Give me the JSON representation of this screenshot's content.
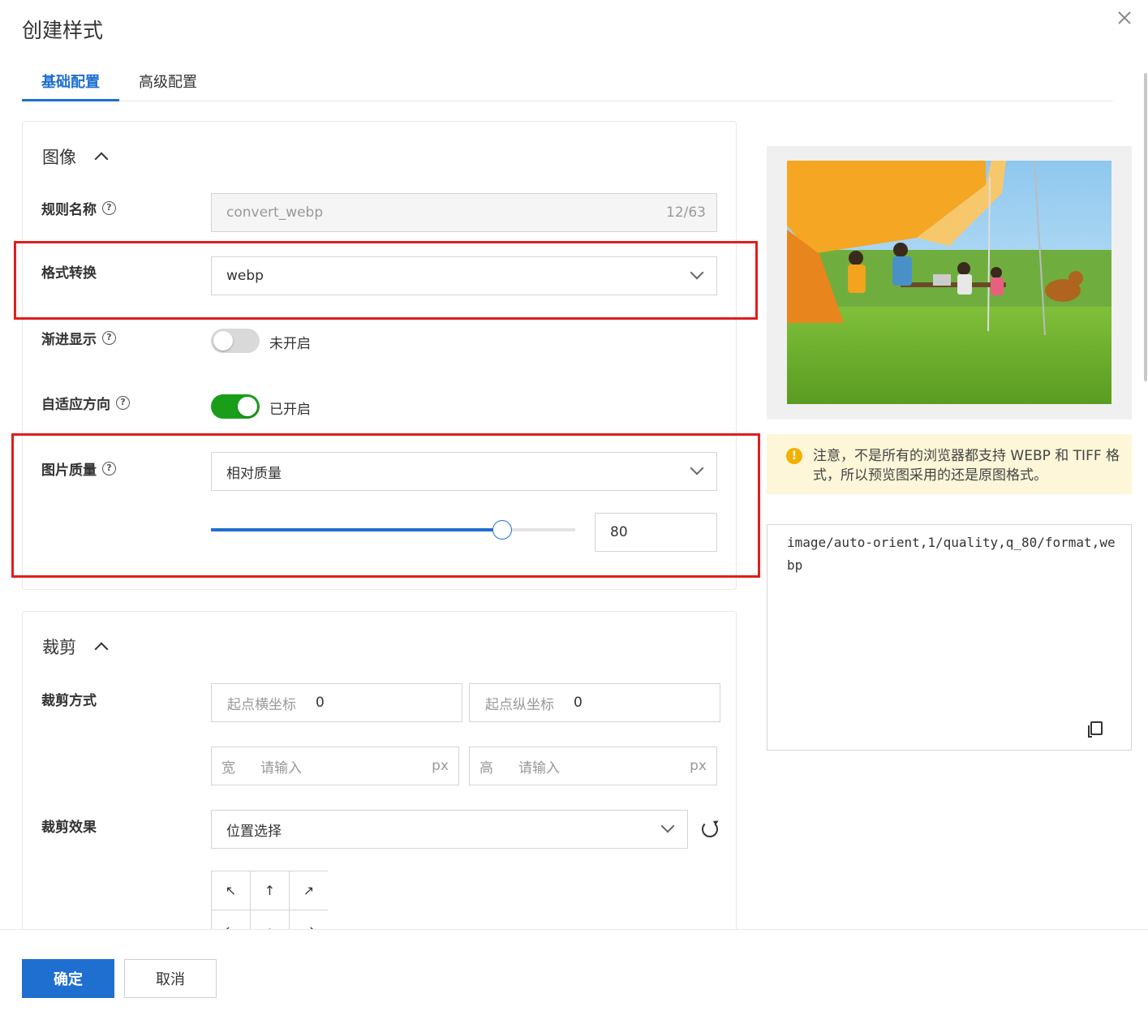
{
  "dialog": {
    "title": "创建样式"
  },
  "tabs": [
    {
      "label": "基础配置",
      "active": true
    },
    {
      "label": "高级配置",
      "active": false
    }
  ],
  "image_section": {
    "heading": "图像",
    "rule_name": {
      "label": "规则名称",
      "value": "convert_webp",
      "counter": "12/63"
    },
    "format": {
      "label": "格式转换",
      "value": "webp"
    },
    "progressive": {
      "label": "渐进显示",
      "enabled": false,
      "status": "未开启"
    },
    "auto_orient": {
      "label": "自适应方向",
      "enabled": true,
      "status": "已开启"
    },
    "quality": {
      "label": "图片质量",
      "mode": "相对质量",
      "value": "80",
      "slider_percent": 80
    }
  },
  "crop_section": {
    "heading": "裁剪",
    "method_label": "裁剪方式",
    "start_x": {
      "label": "起点横坐标",
      "value": "0"
    },
    "start_y": {
      "label": "起点纵坐标",
      "value": "0"
    },
    "width": {
      "label": "宽",
      "placeholder": "请输入",
      "unit": "px"
    },
    "height": {
      "label": "高",
      "placeholder": "请输入",
      "unit": "px"
    },
    "effect_label": "裁剪效果",
    "position_select": "位置选择",
    "position_grid": [
      "↖",
      "↑",
      "↗",
      "←",
      "·",
      "→"
    ]
  },
  "preview": {
    "notice": "注意，不是所有的浏览器都支持 WEBP 和 TIFF 格式，所以预览图采用的还是原图格式。",
    "code": "image/auto-orient,1/quality,q_80/format,webp"
  },
  "footer": {
    "ok_label": "确定",
    "cancel_label": "取消"
  },
  "colors": {
    "primary": "#1f6fd1",
    "toggle_on": "#1a9e1a",
    "highlight_border": "#e01e1e",
    "notice_bg": "#fdf6d8"
  },
  "icons": [
    "close-icon",
    "chevron-up-icon",
    "help-icon",
    "chevron-down-icon",
    "refresh-icon",
    "warning-icon",
    "copy-icon"
  ]
}
